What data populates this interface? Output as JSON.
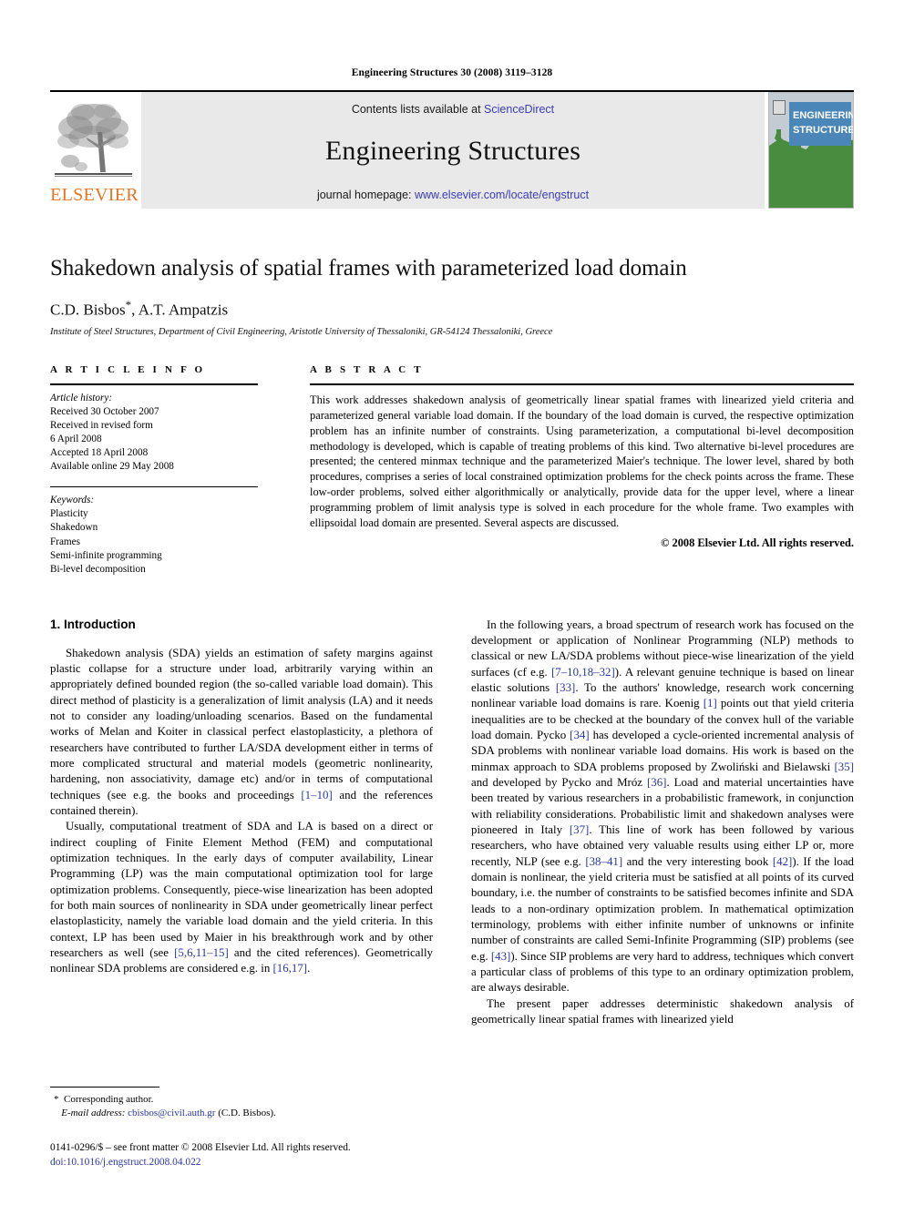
{
  "running_head": "Engineering Structures 30 (2008) 3119–3128",
  "masthead": {
    "publisher_name": "ELSEVIER",
    "contents_prefix": "Contents lists available at ",
    "sciencedirect": "ScienceDirect",
    "journal_name": "Engineering Structures",
    "homepage_prefix": "journal homepage: ",
    "homepage_url": "www.elsevier.com/locate/engstruct",
    "cover_line_1": "ENGINEERING",
    "cover_line_2": "STRUCTURES",
    "brand_orange": "#E87422",
    "link_blue": "#3b3bb5",
    "cover_banner_blue": "#4a86b8",
    "cover_truss_green": "#4a8c3f"
  },
  "title": "Shakedown analysis of spatial frames with parameterized load domain",
  "authors": "C.D. Bisbos",
  "authors_rest": ", A.T. Ampatzis",
  "affiliation": "Institute of Steel Structures, Department of Civil Engineering, Aristotle University of Thessaloniki, GR-54124 Thessaloniki, Greece",
  "article_info": {
    "label": "A R T I C L E   I N F O",
    "history_title": "Article history:",
    "history": [
      "Received 30 October 2007",
      "Received in revised form",
      "6 April 2008",
      "Accepted 18 April 2008",
      "Available online 29 May 2008"
    ],
    "keywords_title": "Keywords:",
    "keywords": [
      "Plasticity",
      "Shakedown",
      "Frames",
      "Semi-infinite programming",
      "Bi-level decomposition"
    ]
  },
  "abstract": {
    "label": "A B S T R A C T",
    "text": "This work addresses shakedown analysis of geometrically linear spatial frames with linearized yield criteria and parameterized general variable load domain. If the boundary of the load domain is curved, the respective optimization problem has an infinite number of constraints. Using parameterization, a computational bi-level decomposition methodology is developed, which is capable of treating problems of this kind. Two alternative bi-level procedures are presented; the centered minmax technique and the parameterized Maier's technique. The lower level, shared by both procedures, comprises a series of local constrained optimization problems for the check points across the frame. These low-order problems, solved either algorithmically or analytically, provide data for the upper level, where a linear programming problem of limit analysis type is solved in each procedure for the whole frame. Two examples with ellipsoidal load domain are presented. Several aspects are discussed.",
    "copyright": "© 2008 Elsevier Ltd. All rights reserved."
  },
  "body": {
    "section_heading": "1.  Introduction",
    "left_paragraphs": [
      "Shakedown analysis (SDA) yields an estimation of safety margins against plastic collapse for a structure under load, arbitrarily varying within an appropriately defined bounded region (the so-called variable load domain). This direct method of plasticity is a generalization of limit analysis (LA) and it needs not to consider any loading/unloading scenarios. Based on the fundamental works of Melan and Koiter in classical perfect elastoplasticity, a plethora of researchers have contributed to further LA/SDA development either in terms of more complicated structural and material models (geometric nonlinearity, hardening, non associativity, damage etc) and/or in terms of computational techniques (see e.g. the books and proceedings [1–10] and the references contained therein).",
      "Usually, computational treatment of SDA and LA is based on a direct or indirect coupling of Finite Element Method (FEM) and computational optimization techniques. In the early days of computer availability, Linear Programming (LP) was the main computational optimization tool for large optimization problems. Consequently, piece-wise linearization has been adopted for both main sources of nonlinearity in SDA under geometrically linear perfect elastoplasticity, namely the variable load domain and the yield criteria. In this context, LP has been used by Maier in his breakthrough work and by other researchers as well (see [5,6,11–15] and the cited references). Geometrically nonlinear SDA problems are considered e.g. in [16,17]."
    ],
    "right_paragraphs": [
      "In the following years, a broad spectrum of research work has focused on the development or application of Nonlinear Programming (NLP) methods to classical or new LA/SDA problems without piece-wise linearization of the yield surfaces (cf e.g. [7–10,18–32]). A relevant genuine technique is based on linear elastic solutions [33]. To the authors' knowledge, research work concerning nonlinear variable load domains is rare. Koenig [1] points out that yield criteria inequalities are to be checked at the boundary of the convex hull of the variable load domain. Pycko [34] has developed a cycle-oriented incremental analysis of SDA problems with nonlinear variable load domains. His work is based on the minmax approach to SDA problems proposed by Zwoliński and Bielawski [35] and developed by Pycko and Mróz [36]. Load and material uncertainties have been treated by various researchers in a probabilistic framework, in conjunction with reliability considerations. Probabilistic limit and shakedown analyses were pioneered in Italy [37]. This line of work has been followed by various researchers, who have obtained very valuable results using either LP or, more recently, NLP (see e.g. [38–41] and the very interesting book [42]). If the load domain is nonlinear, the yield criteria must be satisfied at all points of its curved boundary, i.e. the number of constraints to be satisfied becomes infinite and SDA leads to a non-ordinary optimization problem. In mathematical optimization terminology, problems with either infinite number of unknowns or infinite number of constraints are called Semi-Infinite Programming (SIP) problems (see e.g. [43]). Since SIP problems are very hard to address, techniques which convert a particular class of problems of this type to an ordinary optimization problem, are always desirable.",
      "The present paper addresses deterministic shakedown analysis of geometrically linear spatial frames with linearized yield"
    ]
  },
  "footnotes": {
    "corresponding_author": "Corresponding author.",
    "email_label": "E-mail address:",
    "email": "cbisbos@civil.auth.gr",
    "email_owner": "(C.D. Bisbos).",
    "imprint": "0141-0296/$ – see front matter © 2008 Elsevier Ltd. All rights reserved.",
    "doi": "doi:10.1016/j.engstruct.2008.04.022"
  }
}
